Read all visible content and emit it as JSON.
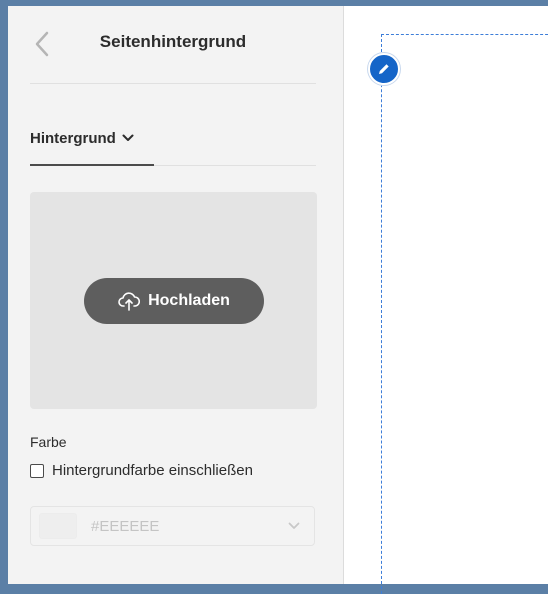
{
  "header": {
    "title": "Seitenhintergrund",
    "back_icon": "chevron-left-icon"
  },
  "tab": {
    "label": "Hintergrund",
    "chevron_icon": "chevron-down-icon"
  },
  "upload": {
    "label": "Hochladen",
    "icon": "cloud-upload-icon"
  },
  "color_section": {
    "label": "Farbe",
    "checkbox_label": "Hintergrundfarbe einschließen",
    "checkbox_checked": false,
    "hex_value": "#EEEEEE",
    "swatch_color": "#EEEEEE"
  },
  "canvas": {
    "edit_icon": "pencil-icon",
    "accent_color": "#1565C8"
  }
}
